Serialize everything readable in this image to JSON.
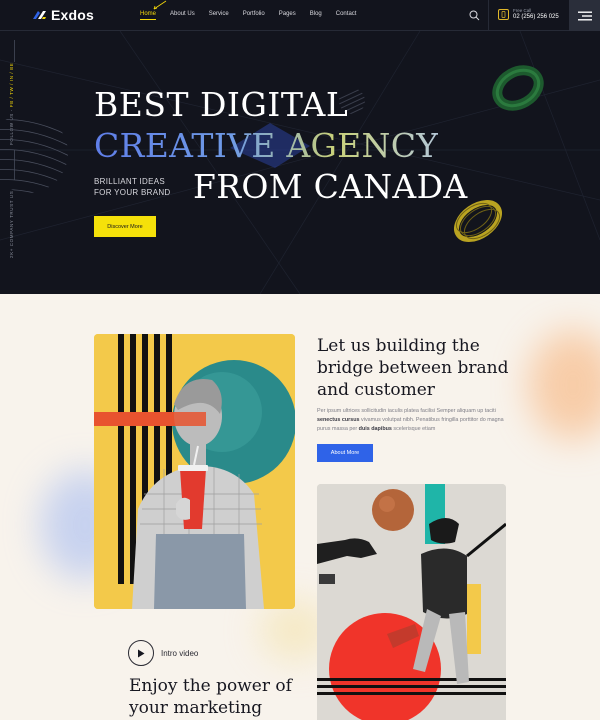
{
  "brand": {
    "name": "Exdos"
  },
  "nav": {
    "items": [
      {
        "label": "Home",
        "active": true
      },
      {
        "label": "About Us"
      },
      {
        "label": "Service"
      },
      {
        "label": "Portfolio"
      },
      {
        "label": "Pages"
      },
      {
        "label": "Blog"
      },
      {
        "label": "Contact"
      }
    ],
    "call_label": "Free Call",
    "call_number": "02 (256) 256 025"
  },
  "side": {
    "follow_label": "FOLLOW US -",
    "follow_links": "FB / TW / IN / BE",
    "trust_label": "2K+ COMPANY TRUST US"
  },
  "hero": {
    "line1": "BEST DIGITAL",
    "line2": "CREATIVE AGENCY",
    "sub_line1": "BRILLIANT IDEAS",
    "sub_line2": "FOR YOUR BRAND",
    "line3": "FROM CANADA",
    "cta": "Discover More"
  },
  "about": {
    "title": "Let us building the bridge between brand and customer",
    "text_a": "Per ipsum ultrices sollicitudin iaculis platea facilisi Semper aliquam up taciti ",
    "text_b1": "senectus cursus",
    "text_c": " vivamus volutpat nibh. Penatibus fringilla porttitor do magna purus massa per ",
    "text_b2": "duis dapibus",
    "text_d": " scelerisque etiam",
    "cta": "About More"
  },
  "video": {
    "label": "Intro video",
    "heading": "Enjoy the power of your marketing"
  },
  "colors": {
    "hero_bg": "#12141d",
    "accent_yellow": "#f5e10a",
    "accent_blue": "#2f63e8",
    "page_bg": "#f8f3ec"
  }
}
